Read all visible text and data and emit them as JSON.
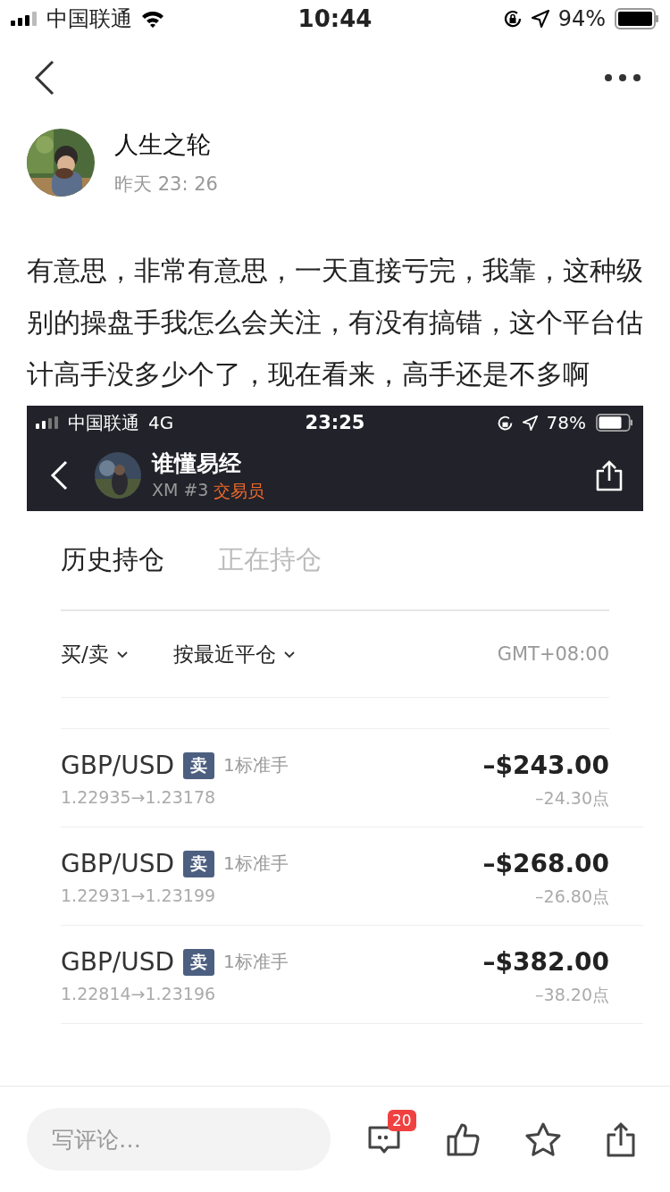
{
  "status_bar": {
    "carrier": "中国联通",
    "time": "10:44",
    "battery": "94%"
  },
  "post": {
    "author": "人生之轮",
    "time": "昨天 23: 26",
    "text": "有意思，非常有意思，一天直接亏完，我靠，这种级别的操盘手我怎么会关注，有没有搞错，这个平台估计高手没多少个了，现在看来，高手还是不多啊"
  },
  "screenshot": {
    "status_bar": {
      "carrier": "中国联通",
      "network": "4G",
      "time": "23:25",
      "battery": "78%"
    },
    "trader": {
      "name": "谁懂易经",
      "rank": "XM #3",
      "role": "交易员"
    },
    "tabs": [
      {
        "label": "历史持仓",
        "selected": true
      },
      {
        "label": "正在持仓",
        "selected": false
      }
    ],
    "filters": [
      "买/卖",
      "按最近平仓"
    ],
    "timezone": "GMT+08:00",
    "trades": [
      {
        "symbol": "GBP/USD",
        "side": "卖",
        "lots": "1标准手",
        "prices": "1.22935→1.23178",
        "amount": "–$243.00",
        "points": "–24.30点"
      },
      {
        "symbol": "GBP/USD",
        "side": "卖",
        "lots": "1标准手",
        "prices": "1.22931→1.23199",
        "amount": "–$268.00",
        "points": "–26.80点"
      },
      {
        "symbol": "GBP/USD",
        "side": "卖",
        "lots": "1标准手",
        "prices": "1.22814→1.23196",
        "amount": "–$382.00",
        "points": "–38.20点"
      }
    ]
  },
  "bottom_bar": {
    "placeholder": "写评论…",
    "comment_count": "20"
  }
}
